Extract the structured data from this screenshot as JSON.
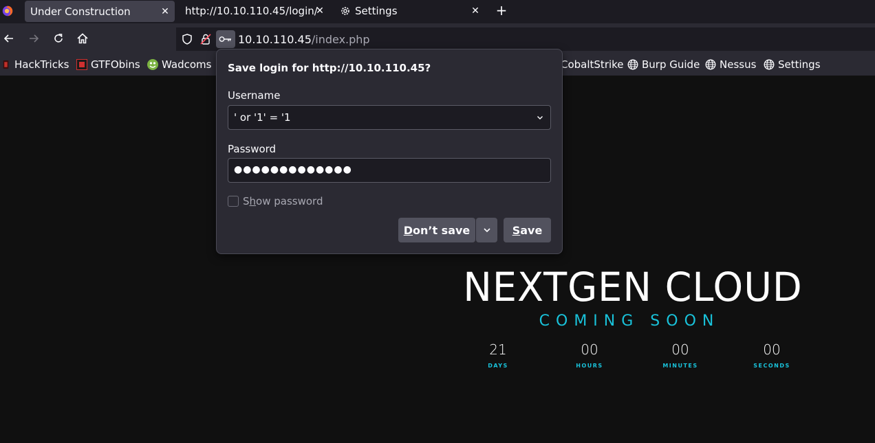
{
  "tabs": [
    {
      "label": "Under Construction"
    },
    {
      "label": "http://10.10.110.45/login/"
    },
    {
      "label": "Settings"
    }
  ],
  "url": {
    "host": "10.10.110.45",
    "path": "/index.php"
  },
  "bookmarks": [
    {
      "label": "HackTricks"
    },
    {
      "label": "GTFObins"
    },
    {
      "label": "Wadcoms"
    },
    {
      "label": "CobaltStrike"
    },
    {
      "label": "Burp Guide"
    },
    {
      "label": "Nessus"
    },
    {
      "label": "Settings"
    }
  ],
  "popup": {
    "title": "Save login for http://10.10.110.45?",
    "username_label": "Username",
    "username_value": "' or '1' = '1",
    "password_label": "Password",
    "password_value": "●●●●●●●●●●●●●",
    "show_password_label_pre": "S",
    "show_password_label_u": "h",
    "show_password_label_post": "ow password",
    "dont_save_u": "D",
    "dont_save_rest": "on’t save",
    "save_u": "S",
    "save_rest": "ave"
  },
  "page": {
    "title": "NEXTGEN CLOUD",
    "subtitle": "COMING SOON",
    "countdown": [
      {
        "value": "21",
        "label": "DAYS"
      },
      {
        "value": "00",
        "label": "HOURS"
      },
      {
        "value": "00",
        "label": "MINUTES"
      },
      {
        "value": "00",
        "label": "SECONDS"
      }
    ]
  },
  "colors": {
    "accent": "#19c2da",
    "chrome": "#2b2a33",
    "tabstrip": "#1c1b22"
  }
}
